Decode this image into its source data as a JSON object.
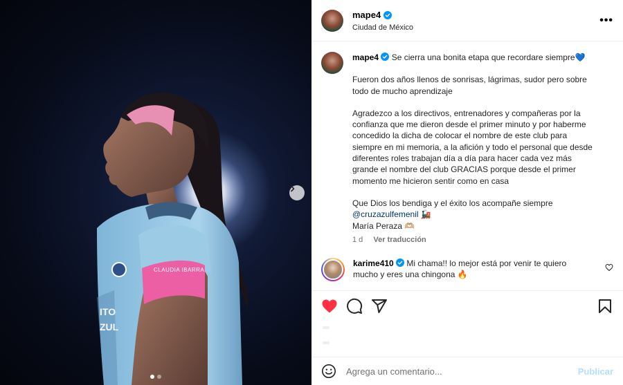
{
  "post": {
    "username": "mape4",
    "location": "Ciudad de México",
    "more_label": "•••"
  },
  "caption": {
    "author": "mape4",
    "first_line": "Se cierra una bonita etapa que recordare siempre💙",
    "paragraph_1": "Fueron dos años llenos de sonrisas, lágrimas, sudor pero sobre todo de mucho aprendizaje",
    "paragraph_2": "Agradezco a los directivos, entrenadores y compañeras por la confianza que me dieron desde el primer minuto y por haberme concedido la dicha de colocar el nombre de este club para siempre en mi memoria, a la afición y todo el personal que desde diferentes roles trabajan día a día para hacer cada vez más grande el nombre del club GRACIAS porque desde el primer momento me hicieron sentir como en casa",
    "closing": "Que Dios los bendiga y el éxito los acompañe siempre",
    "mention": "@cruzazulfemenil",
    "mention_emoji": "🚂",
    "signature": "María Peraza 🫶🏼",
    "time": "1 d",
    "translate": "Ver traducción"
  },
  "comments": [
    {
      "author": "karime410",
      "text": "Mi chama!! lo mejor está por venir te quiero mucho y eres una chingona 🔥"
    }
  ],
  "photo": {
    "armband_text": "CLAUDIA IBARRA",
    "jersey_text": "ITO ZUL"
  },
  "add_comment": {
    "placeholder": "Agrega un comentario...",
    "publish_label": "Publicar"
  },
  "icons": [
    "verified-icon",
    "more-icon",
    "heart-icon",
    "comment-icon",
    "share-icon",
    "bookmark-icon",
    "emoji-icon",
    "chevron-right-icon"
  ],
  "colors": {
    "liked_heart": "#ff3040",
    "verified": "#0095f6",
    "publish_disabled": "#b2dffc",
    "mention": "#00376b"
  }
}
